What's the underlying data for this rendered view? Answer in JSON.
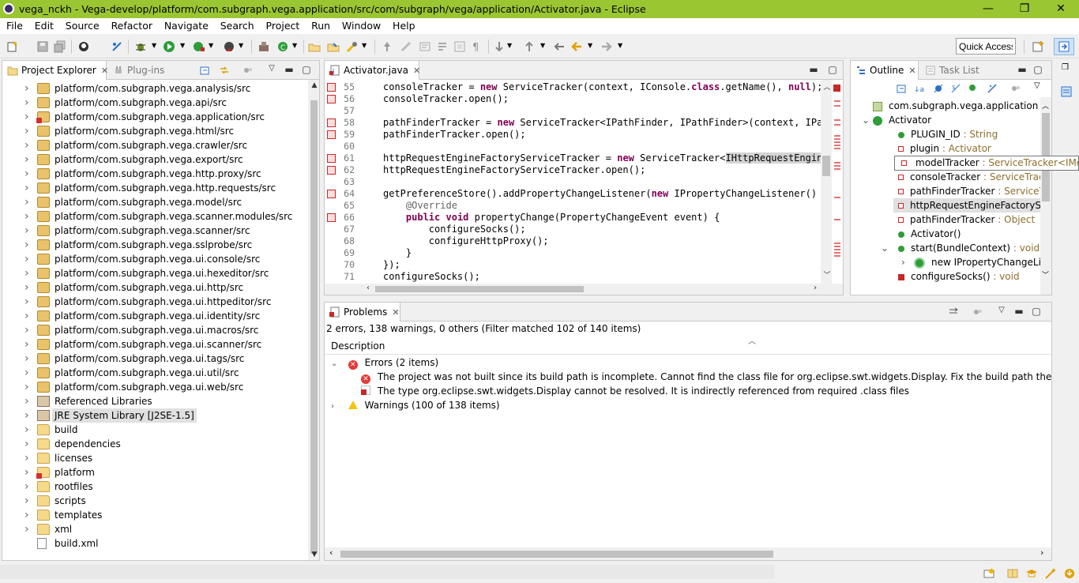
{
  "window": {
    "title": "vega_nckh - Vega-develop/platform/com.subgraph.vega.application/src/com/subgraph/vega/application/Activator.java - Eclipse",
    "minimize": "—",
    "maximize": "❐",
    "close": "✕"
  },
  "menu": [
    "File",
    "Edit",
    "Source",
    "Refactor",
    "Navigate",
    "Search",
    "Project",
    "Run",
    "Window",
    "Help"
  ],
  "toolbar": {
    "quick_access": "Quick Access"
  },
  "project_explorer": {
    "tabs": [
      "Project Explorer",
      "Plug-ins"
    ],
    "items": [
      {
        "label": "platform/com.subgraph.vega.analysis/src",
        "type": "pkg",
        "error": false
      },
      {
        "label": "platform/com.subgraph.vega.api/src",
        "type": "pkg",
        "error": false
      },
      {
        "label": "platform/com.subgraph.vega.application/src",
        "type": "pkg",
        "error": true
      },
      {
        "label": "platform/com.subgraph.vega.html/src",
        "type": "pkg",
        "error": false
      },
      {
        "label": "platform/com.subgraph.vega.crawler/src",
        "type": "pkg",
        "error": false
      },
      {
        "label": "platform/com.subgraph.vega.export/src",
        "type": "pkg",
        "error": false
      },
      {
        "label": "platform/com.subgraph.vega.http.proxy/src",
        "type": "pkg",
        "error": false
      },
      {
        "label": "platform/com.subgraph.vega.http.requests/src",
        "type": "pkg",
        "error": false
      },
      {
        "label": "platform/com.subgraph.vega.model/src",
        "type": "pkg",
        "error": false
      },
      {
        "label": "platform/com.subgraph.vega.scanner.modules/src",
        "type": "pkg",
        "error": false
      },
      {
        "label": "platform/com.subgraph.vega.scanner/src",
        "type": "pkg",
        "error": false
      },
      {
        "label": "platform/com.subgraph.vega.sslprobe/src",
        "type": "pkg",
        "error": false
      },
      {
        "label": "platform/com.subgraph.vega.ui.console/src",
        "type": "pkg",
        "error": false
      },
      {
        "label": "platform/com.subgraph.vega.ui.hexeditor/src",
        "type": "pkg",
        "error": false
      },
      {
        "label": "platform/com.subgraph.vega.ui.http/src",
        "type": "pkg",
        "error": false
      },
      {
        "label": "platform/com.subgraph.vega.ui.httpeditor/src",
        "type": "pkg",
        "error": false
      },
      {
        "label": "platform/com.subgraph.vega.ui.identity/src",
        "type": "pkg",
        "error": false
      },
      {
        "label": "platform/com.subgraph.vega.ui.macros/src",
        "type": "pkg",
        "error": false
      },
      {
        "label": "platform/com.subgraph.vega.ui.scanner/src",
        "type": "pkg",
        "error": false
      },
      {
        "label": "platform/com.subgraph.vega.ui.tags/src",
        "type": "pkg",
        "error": false
      },
      {
        "label": "platform/com.subgraph.vega.ui.util/src",
        "type": "pkg",
        "error": false
      },
      {
        "label": "platform/com.subgraph.vega.ui.web/src",
        "type": "pkg",
        "error": false
      },
      {
        "label": "Referenced Libraries",
        "type": "lib",
        "error": false
      },
      {
        "label": "JRE System Library [J2SE-1.5]",
        "type": "lib",
        "error": false,
        "selected": true
      },
      {
        "label": "build",
        "type": "folder",
        "error": false
      },
      {
        "label": "dependencies",
        "type": "folder",
        "error": false
      },
      {
        "label": "licenses",
        "type": "folder",
        "error": false
      },
      {
        "label": "platform",
        "type": "folder",
        "error": true
      },
      {
        "label": "rootfiles",
        "type": "folder",
        "error": false
      },
      {
        "label": "scripts",
        "type": "folder",
        "error": false
      },
      {
        "label": "templates",
        "type": "folder",
        "error": false
      },
      {
        "label": "xml",
        "type": "folder",
        "error": false
      },
      {
        "label": "build.xml",
        "type": "file",
        "error": false
      }
    ]
  },
  "editor": {
    "tab": "Activator.java",
    "lines": [
      {
        "n": "55",
        "err": true,
        "html": "consoleTracker = <span class=\"kw\">new</span> ServiceTracker(context, IConsole.<span class=\"kw\">class</span>.getName(), <span class=\"kw\">null</span>);"
      },
      {
        "n": "56",
        "err": true,
        "html": "consoleTracker.open();"
      },
      {
        "n": "57",
        "err": false,
        "html": ""
      },
      {
        "n": "58",
        "err": true,
        "html": "pathFinderTracker = <span class=\"kw\">new</span> ServiceTracker&lt;IPathFinder, IPathFinder&gt;(context, IPath"
      },
      {
        "n": "59",
        "err": true,
        "html": "pathFinderTracker.open();"
      },
      {
        "n": "60",
        "err": false,
        "html": ""
      },
      {
        "n": "61",
        "err": true,
        "html": "httpRequestEngineFactoryServiceTracker = <span class=\"kw\">new</span> ServiceTracker&lt;<span class=\"hl\">IHttpRequestEngineF</span>"
      },
      {
        "n": "62",
        "err": true,
        "html": "httpRequestEngineFactoryServiceTracker.open();"
      },
      {
        "n": "63",
        "err": false,
        "html": ""
      },
      {
        "n": "64",
        "err": true,
        "html": "getPreferenceStore().addPropertyChangeListener(<span class=\"kw\">new</span> IPropertyChangeListener() {"
      },
      {
        "n": "65",
        "err": false,
        "html": "    <span class=\"ann\">@Override</span>"
      },
      {
        "n": "66",
        "err": true,
        "html": "    <span class=\"kw\">public</span> <span class=\"kw\">void</span> propertyChange(PropertyChangeEvent event) {"
      },
      {
        "n": "67",
        "err": false,
        "html": "        configureSocks();"
      },
      {
        "n": "68",
        "err": false,
        "html": "        configureHttpProxy();"
      },
      {
        "n": "69",
        "err": false,
        "html": "    }"
      },
      {
        "n": "70",
        "err": false,
        "html": "});"
      },
      {
        "n": "71",
        "err": false,
        "html": "configureSocks();"
      }
    ]
  },
  "outline": {
    "tabs": [
      "Outline",
      "Task List"
    ],
    "items": [
      {
        "label": "com.subgraph.vega.application",
        "type": "",
        "indent": 0,
        "icon": "import"
      },
      {
        "label": "Activator",
        "type": "",
        "indent": 0,
        "icon": "class",
        "arrow": "⌄"
      },
      {
        "label": "PLUGIN_ID",
        "type": " : String",
        "indent": 1,
        "icon": "const"
      },
      {
        "label": "plugin",
        "type": " : Activator",
        "indent": 1,
        "icon": "static"
      },
      {
        "label": "modelTracker",
        "type": " : ServiceTracker<IModel, IModel>",
        "indent": 1,
        "icon": "field",
        "tooltip": true
      },
      {
        "label": "consoleTracker",
        "type": " : ServiceTracker<IConsole, IConsole>",
        "indent": 1,
        "icon": "field"
      },
      {
        "label": "pathFinderTracker",
        "type": " : ServiceTracker<IPathFinder, IPathFinder>",
        "indent": 1,
        "icon": "field"
      },
      {
        "label": "httpRequestEngineFactoryServiceTracker",
        "type": "",
        "indent": 1,
        "icon": "field",
        "selected": true
      },
      {
        "label": "pathFinderTracker",
        "type": " : Object",
        "indent": 1,
        "icon": "field"
      },
      {
        "label": "Activator()",
        "type": "",
        "indent": 1,
        "icon": "ctor"
      },
      {
        "label": "start(BundleContext)",
        "type": " : void",
        "indent": 1,
        "icon": "method",
        "arrow": "⌄"
      },
      {
        "label": "new IPropertyChangeListener() {...}",
        "type": "",
        "indent": 2,
        "icon": "anon",
        "arrow": "›"
      },
      {
        "label": "configureSocks()",
        "type": " : void",
        "indent": 1,
        "icon": "private"
      }
    ]
  },
  "problems": {
    "tab": "Problems",
    "summary": "2 errors, 138 warnings, 0 others (Filter matched 102 of 140 items)",
    "column": "Description",
    "errors_label": "Errors (2 items)",
    "errors": [
      "The project was not built since its build path is incomplete. Cannot find the class file for org.eclipse.swt.widgets.Display. Fix the build path then try building this project",
      "The type org.eclipse.swt.widgets.Display cannot be resolved. It is indirectly referenced from required .class files"
    ],
    "warnings_label": "Warnings (100 of 138 items)"
  }
}
